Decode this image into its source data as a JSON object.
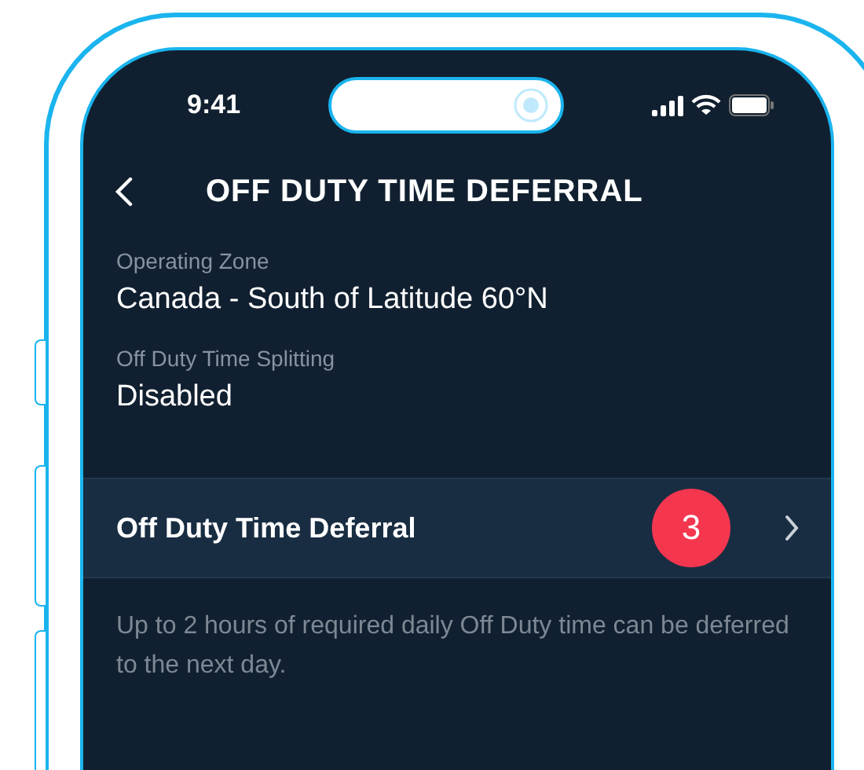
{
  "status_bar": {
    "time": "9:41"
  },
  "header": {
    "title": "OFF DUTY TIME DEFERRAL"
  },
  "fields": [
    {
      "label": "Operating Zone",
      "value": "Canada - South of Latitude 60°N"
    },
    {
      "label": "Off Duty Time Splitting",
      "value": "Disabled"
    }
  ],
  "deferral_row": {
    "label": "Off Duty Time Deferral",
    "badge": "3"
  },
  "description": "Up to 2 hours of required daily Off Duty time can be deferred to the next day."
}
